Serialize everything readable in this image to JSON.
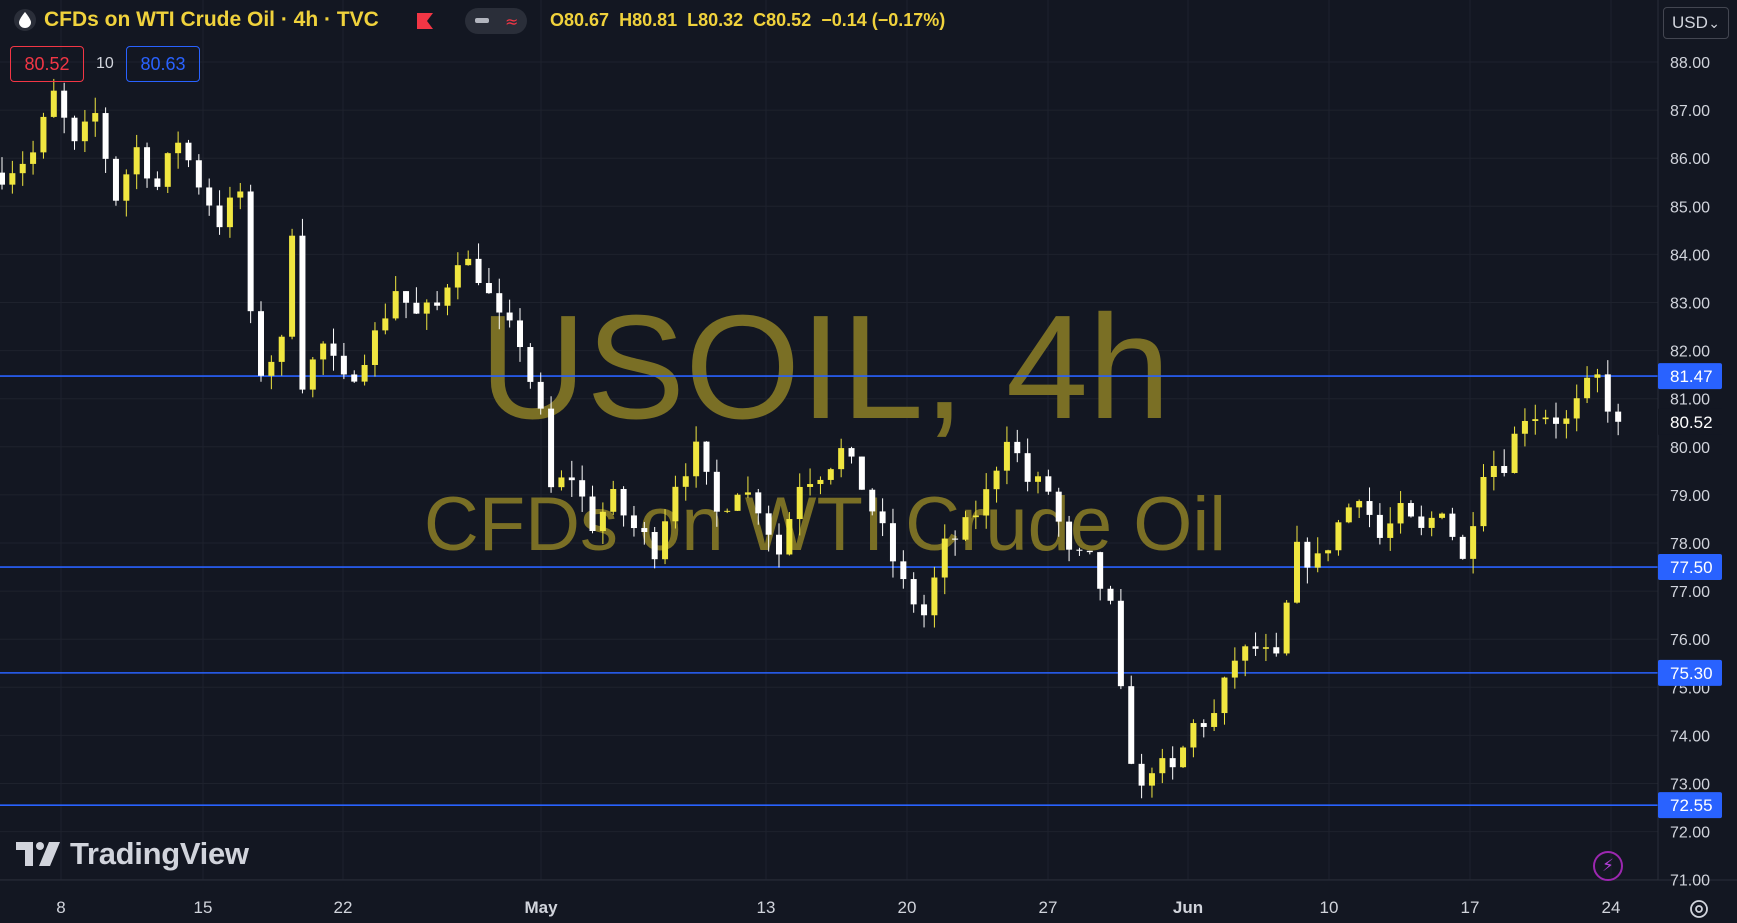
{
  "header": {
    "title": "CFDs on WTI Crude Oil · 4h · TVC",
    "ohlc": [
      {
        "label": "O",
        "value": "80.67"
      },
      {
        "label": "H",
        "value": "80.81"
      },
      {
        "label": "L",
        "value": "80.32"
      },
      {
        "label": "C",
        "value": "80.52"
      }
    ],
    "change": "−0.14 (−0.17%)"
  },
  "quote": {
    "bid": "80.52",
    "spread": "10",
    "ask": "80.63"
  },
  "currency": "USD",
  "watermark": {
    "line1": "USOIL, 4h",
    "line2": "CFDs on WTI Crude Oil"
  },
  "branding": {
    "logo_text": "TradingView"
  },
  "colors": {
    "background": "#131722",
    "grid": "#1e222d",
    "candle_up": "#f0e640",
    "candle_down": "#ffffff",
    "hline": "#2962ff",
    "watermark": "#7a6f25",
    "text": "#d1d4dc"
  },
  "chart_data": {
    "type": "candlestick",
    "symbol": "USOIL",
    "timeframe": "4h",
    "ylim": [
      71,
      88.5
    ],
    "y_ticks": [
      "88.00",
      "87.00",
      "86.00",
      "85.00",
      "84.00",
      "83.00",
      "82.00",
      "81.00",
      "80.00",
      "79.00",
      "78.00",
      "77.00",
      "76.00",
      "75.00",
      "74.00",
      "73.00",
      "72.00",
      "71.00"
    ],
    "x_ticks": [
      "8",
      "15",
      "22",
      "May",
      "13",
      "20",
      "27",
      "Jun",
      "10",
      "17",
      "24"
    ],
    "last_price": "80.52",
    "horizontal_lines": [
      {
        "price": 81.47,
        "label": "81.47"
      },
      {
        "price": 77.5,
        "label": "77.50"
      },
      {
        "price": 75.3,
        "label": "75.30"
      },
      {
        "price": 72.55,
        "label": "72.55"
      }
    ],
    "close_path": [
      [
        0,
        85.7
      ],
      [
        3,
        86.1
      ],
      [
        5,
        87.3
      ],
      [
        7,
        86.2
      ],
      [
        9,
        86.9
      ],
      [
        11,
        85.2
      ],
      [
        13,
        86.2
      ],
      [
        15,
        85.4
      ],
      [
        17,
        86.4
      ],
      [
        19,
        85.5
      ],
      [
        21,
        84.7
      ],
      [
        23,
        85.3
      ],
      [
        24,
        82.6
      ],
      [
        25,
        81.6
      ],
      [
        27,
        82.1
      ],
      [
        28,
        84.6
      ],
      [
        29,
        81.4
      ],
      [
        31,
        82.1
      ],
      [
        33,
        81.3
      ],
      [
        34,
        81.6
      ],
      [
        36,
        82.3
      ],
      [
        38,
        83.3
      ],
      [
        40,
        82.7
      ],
      [
        42,
        82.9
      ],
      [
        44,
        84.0
      ],
      [
        46,
        83.6
      ],
      [
        48,
        82.6
      ],
      [
        50,
        82.2
      ],
      [
        52,
        80.6
      ],
      [
        53,
        79.1
      ],
      [
        55,
        79.4
      ],
      [
        57,
        78.4
      ],
      [
        59,
        78.9
      ],
      [
        61,
        78.3
      ],
      [
        63,
        77.9
      ],
      [
        65,
        79.3
      ],
      [
        67,
        79.9
      ],
      [
        69,
        78.6
      ],
      [
        71,
        79.2
      ],
      [
        73,
        78.8
      ],
      [
        75,
        77.8
      ],
      [
        77,
        79.3
      ],
      [
        79,
        79.5
      ],
      [
        81,
        79.9
      ],
      [
        83,
        79.2
      ],
      [
        85,
        78.2
      ],
      [
        87,
        77.1
      ],
      [
        89,
        76.5
      ],
      [
        91,
        77.9
      ],
      [
        93,
        78.3
      ],
      [
        95,
        79.0
      ],
      [
        97,
        80.3
      ],
      [
        99,
        79.3
      ],
      [
        101,
        79.1
      ],
      [
        103,
        77.7
      ],
      [
        105,
        77.6
      ],
      [
        107,
        76.6
      ],
      [
        108,
        74.8
      ],
      [
        109,
        73.6
      ],
      [
        110,
        72.8
      ],
      [
        111,
        73.4
      ],
      [
        113,
        73.2
      ],
      [
        115,
        74.2
      ],
      [
        117,
        74.4
      ],
      [
        119,
        75.6
      ],
      [
        121,
        75.8
      ],
      [
        123,
        75.5
      ],
      [
        125,
        77.8
      ],
      [
        127,
        77.6
      ],
      [
        129,
        78.4
      ],
      [
        131,
        79.1
      ],
      [
        133,
        78.1
      ],
      [
        135,
        78.6
      ],
      [
        137,
        78.2
      ],
      [
        139,
        78.8
      ],
      [
        141,
        77.6
      ],
      [
        143,
        79.6
      ],
      [
        145,
        79.7
      ],
      [
        147,
        80.7
      ],
      [
        149,
        80.7
      ],
      [
        151,
        80.5
      ],
      [
        153,
        81.2
      ],
      [
        154,
        81.4
      ],
      [
        155,
        80.9
      ],
      [
        156,
        80.52
      ]
    ]
  }
}
